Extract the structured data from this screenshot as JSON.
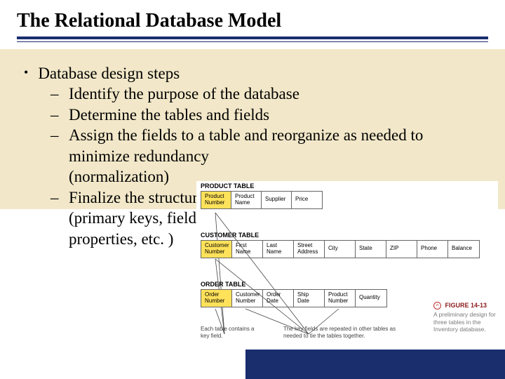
{
  "title": "The Relational Database Model",
  "bullets": {
    "l1": "Database design steps",
    "l2a": "Identify the purpose of the database",
    "l2b": "Determine the tables and fields",
    "l2c": "Assign the fields to a table and reorganize as needed to minimize redundancy (normalization)",
    "l2d": "Finalize the structure (primary keys, field properties, etc. )"
  },
  "diagram": {
    "product": {
      "label": "PRODUCT TABLE",
      "cols": [
        "Product Number",
        "Product Name",
        "Supplier",
        "Price"
      ]
    },
    "customer": {
      "label": "CUSTOMER TABLE",
      "cols": [
        "Customer Number",
        "First Name",
        "Last Name",
        "Street Address",
        "City",
        "State",
        "ZIP",
        "Phone",
        "Balance"
      ]
    },
    "order": {
      "label": "ORDER TABLE",
      "cols": [
        "Order Number",
        "Customer Number",
        "Order Date",
        "Ship Date",
        "Product Number",
        "Quantity"
      ]
    },
    "caption_left": "Each table contains a key field.",
    "caption_right": "The key fields are repeated in other tables as needed to tie the tables together.",
    "figure": {
      "glyph": "Ⓐ",
      "num": "FIGURE 14-13",
      "text": "A preliminary design for three tables in the Inventory database."
    }
  }
}
